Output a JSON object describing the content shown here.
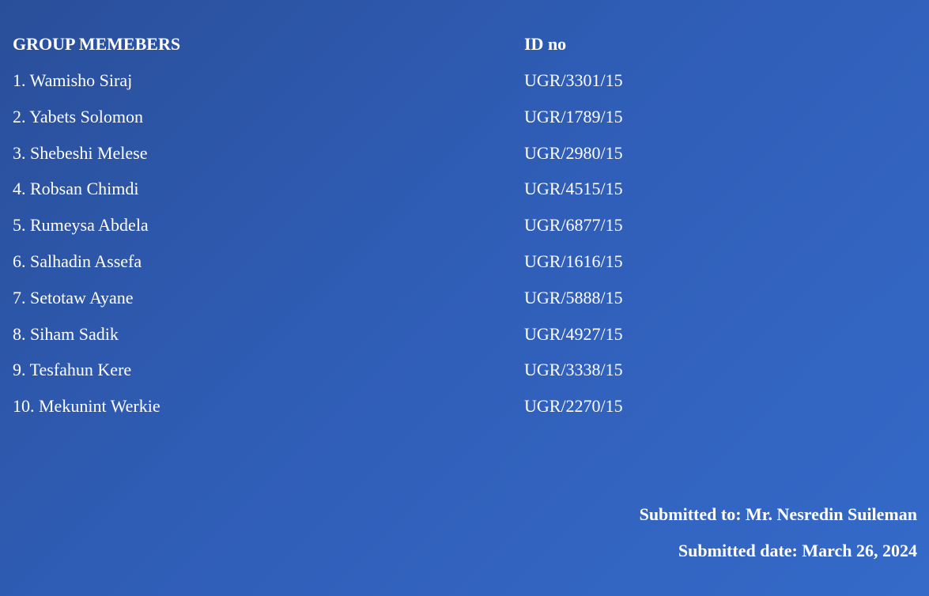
{
  "table": {
    "header_name": "GROUP MEMEBERS",
    "header_id": "ID no",
    "members": [
      {
        "name": "1. Wamisho Siraj",
        "id": "UGR/3301/15"
      },
      {
        "name": "2. Yabets Solomon",
        "id": "UGR/1789/15"
      },
      {
        "name": "3. Shebeshi Melese",
        "id": "UGR/2980/15"
      },
      {
        "name": "4. Robsan Chimdi",
        "id": "UGR/4515/15"
      },
      {
        "name": "5. Rumeysa Abdela",
        "id": "UGR/6877/15"
      },
      {
        "name": "6. Salhadin Assefa",
        "id": "UGR/1616/15"
      },
      {
        "name": "7. Setotaw Ayane",
        "id": "UGR/5888/15"
      },
      {
        "name": "8. Siham Sadik",
        "id": "UGR/4927/15"
      },
      {
        "name": "9. Tesfahun Kere",
        "id": "UGR/3338/15"
      },
      {
        "name": "10. Mekunint Werkie",
        "id": "UGR/2270/15"
      }
    ]
  },
  "footer": {
    "submitted_to": "Submitted to: Mr. Nesredin Suileman",
    "submitted_date": "Submitted date: March 26, 2024"
  },
  "colors": {
    "background_start": "#2a4f9a",
    "background_end": "#356ac9",
    "text": "#ffffff"
  }
}
